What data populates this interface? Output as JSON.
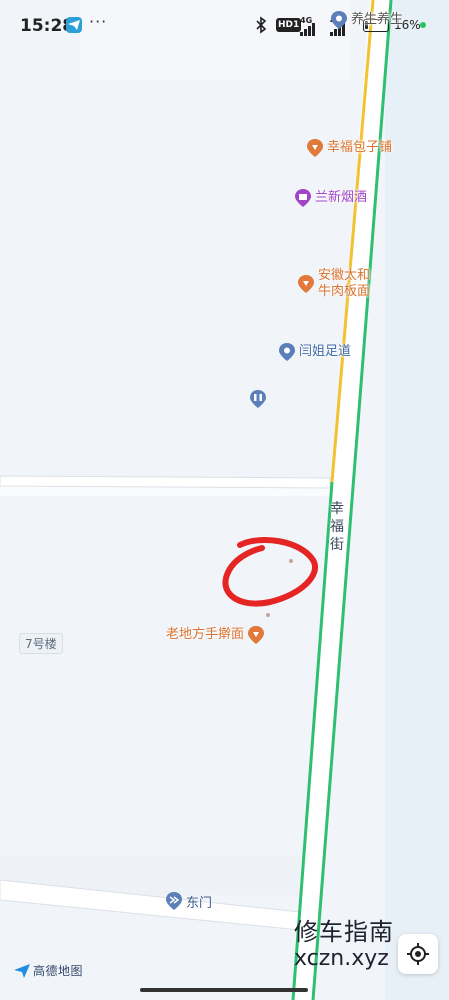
{
  "status_bar": {
    "time": "15:28",
    "hd_badge": "HD1",
    "signal_1_label": "4G",
    "signal_2_label": "4G",
    "battery_percent": "16%",
    "battery_level": 0.16,
    "icons": [
      "telegram-icon",
      "more-dots-icon",
      "bluetooth-icon",
      "signal-icon",
      "battery-icon"
    ]
  },
  "map": {
    "pois": [
      {
        "name": "幸福包子铺",
        "color": "orange",
        "icon": "food-pin-icon"
      },
      {
        "name": "兰新烟酒",
        "color": "purple",
        "icon": "shop-pin-icon"
      },
      {
        "name": "安徽太和牛肉板面",
        "color": "orange",
        "icon": "food-pin-icon"
      },
      {
        "name": "闫姐足道",
        "color": "blue",
        "icon": "place-pin-icon"
      },
      {
        "name": "老地方手擀面",
        "color": "orange",
        "icon": "food-pin-icon"
      }
    ],
    "top_partial_label": "养生养生",
    "street_label": "幸福街",
    "building_label": "7号楼",
    "gate_label": "东门",
    "annotation": "red-circle-marker",
    "colors": {
      "background": "#f1f4f8",
      "road_yellow": "#f2c230",
      "road_green": "#2fbf71",
      "annotation_red": "#e52424",
      "poi_orange": "#d9722e",
      "poi_purple": "#a045c8",
      "poi_blue": "#3f6aa8"
    }
  },
  "branding": {
    "logo_text": "高德地图",
    "watermark_cn": "修车指南",
    "watermark_en": "xczn.xyz"
  },
  "controls": {
    "locate_button": "locate-icon"
  }
}
